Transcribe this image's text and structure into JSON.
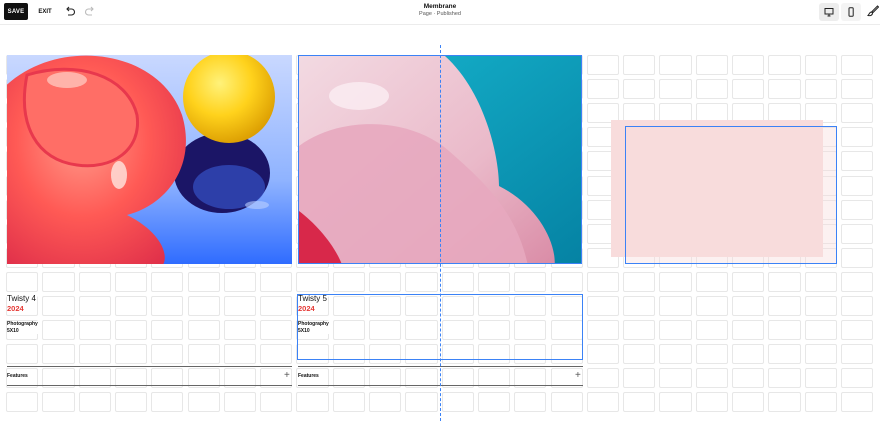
{
  "toolbar": {
    "save_label": "SAVE",
    "exit_label": "EXIT",
    "title": "Membrane",
    "subtitle": "Page · Published"
  },
  "icons": {
    "undo": "undo-icon",
    "redo": "redo-icon",
    "desktop": "desktop-icon",
    "mobile": "mobile-icon",
    "style": "paint-brush-icon"
  },
  "colors": {
    "accent": "#3b82f6",
    "year": "#e53935",
    "pink_block": "#f8dcdc"
  },
  "cards": [
    {
      "title": "Twisty 4",
      "year": "2024",
      "category": "Photography",
      "size": "5X10",
      "features_label": "Features"
    },
    {
      "title": "Twisty 5",
      "year": "2024",
      "category": "Photography",
      "size": "5X10",
      "features_label": "Features"
    }
  ]
}
